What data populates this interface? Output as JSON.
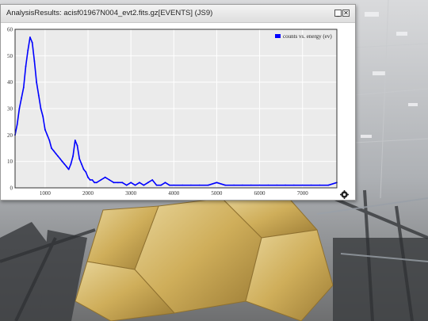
{
  "window": {
    "title": "AnalysisResults: acisf01967N004_evt2.fits.gz[EVENTS] (JS9)",
    "minimize_label": "_",
    "close_label": "✕",
    "settings_icon": "gear-icon"
  },
  "colors": {
    "series": "#0000ff",
    "plot_bg": "#ebebeb",
    "grid": "#ffffff",
    "axis": "#333333"
  },
  "chart_data": {
    "type": "line",
    "title": "",
    "xlabel": "",
    "ylabel": "",
    "xlim": [
      300,
      7800
    ],
    "ylim": [
      0,
      60
    ],
    "x_ticks": [
      1000,
      2000,
      3000,
      4000,
      5000,
      6000,
      7000
    ],
    "y_ticks": [
      0,
      10,
      20,
      30,
      40,
      50,
      60
    ],
    "grid": true,
    "legend_position": "top-right",
    "series": [
      {
        "name": "counts vs. energy (ev)",
        "color": "#0000ff",
        "x": [
          300,
          350,
          400,
          450,
          500,
          550,
          600,
          650,
          700,
          750,
          800,
          850,
          900,
          950,
          1000,
          1050,
          1100,
          1150,
          1200,
          1250,
          1300,
          1350,
          1400,
          1450,
          1500,
          1550,
          1600,
          1650,
          1700,
          1750,
          1800,
          1850,
          1900,
          1950,
          2000,
          2050,
          2100,
          2150,
          2200,
          2300,
          2400,
          2500,
          2600,
          2700,
          2800,
          2900,
          3000,
          3100,
          3200,
          3300,
          3400,
          3500,
          3600,
          3700,
          3800,
          3900,
          4000,
          4200,
          4400,
          4600,
          4800,
          5000,
          5200,
          5400,
          5600,
          5800,
          6000,
          6200,
          6400,
          6600,
          6800,
          7000,
          7200,
          7400,
          7600,
          7800
        ],
        "y": [
          20,
          24,
          30,
          34,
          38,
          46,
          52,
          57,
          55,
          48,
          40,
          35,
          30,
          27,
          22,
          20,
          18,
          15,
          14,
          13,
          12,
          11,
          10,
          9,
          8,
          7,
          9,
          12,
          18,
          16,
          11,
          9,
          7,
          6,
          4,
          3,
          3,
          2,
          2,
          3,
          4,
          3,
          2,
          2,
          2,
          1,
          2,
          1,
          2,
          1,
          2,
          3,
          1,
          1,
          2,
          1,
          1,
          1,
          1,
          1,
          1,
          2,
          1,
          1,
          1,
          1,
          1,
          1,
          1,
          1,
          1,
          1,
          1,
          1,
          1,
          2
        ]
      }
    ]
  }
}
